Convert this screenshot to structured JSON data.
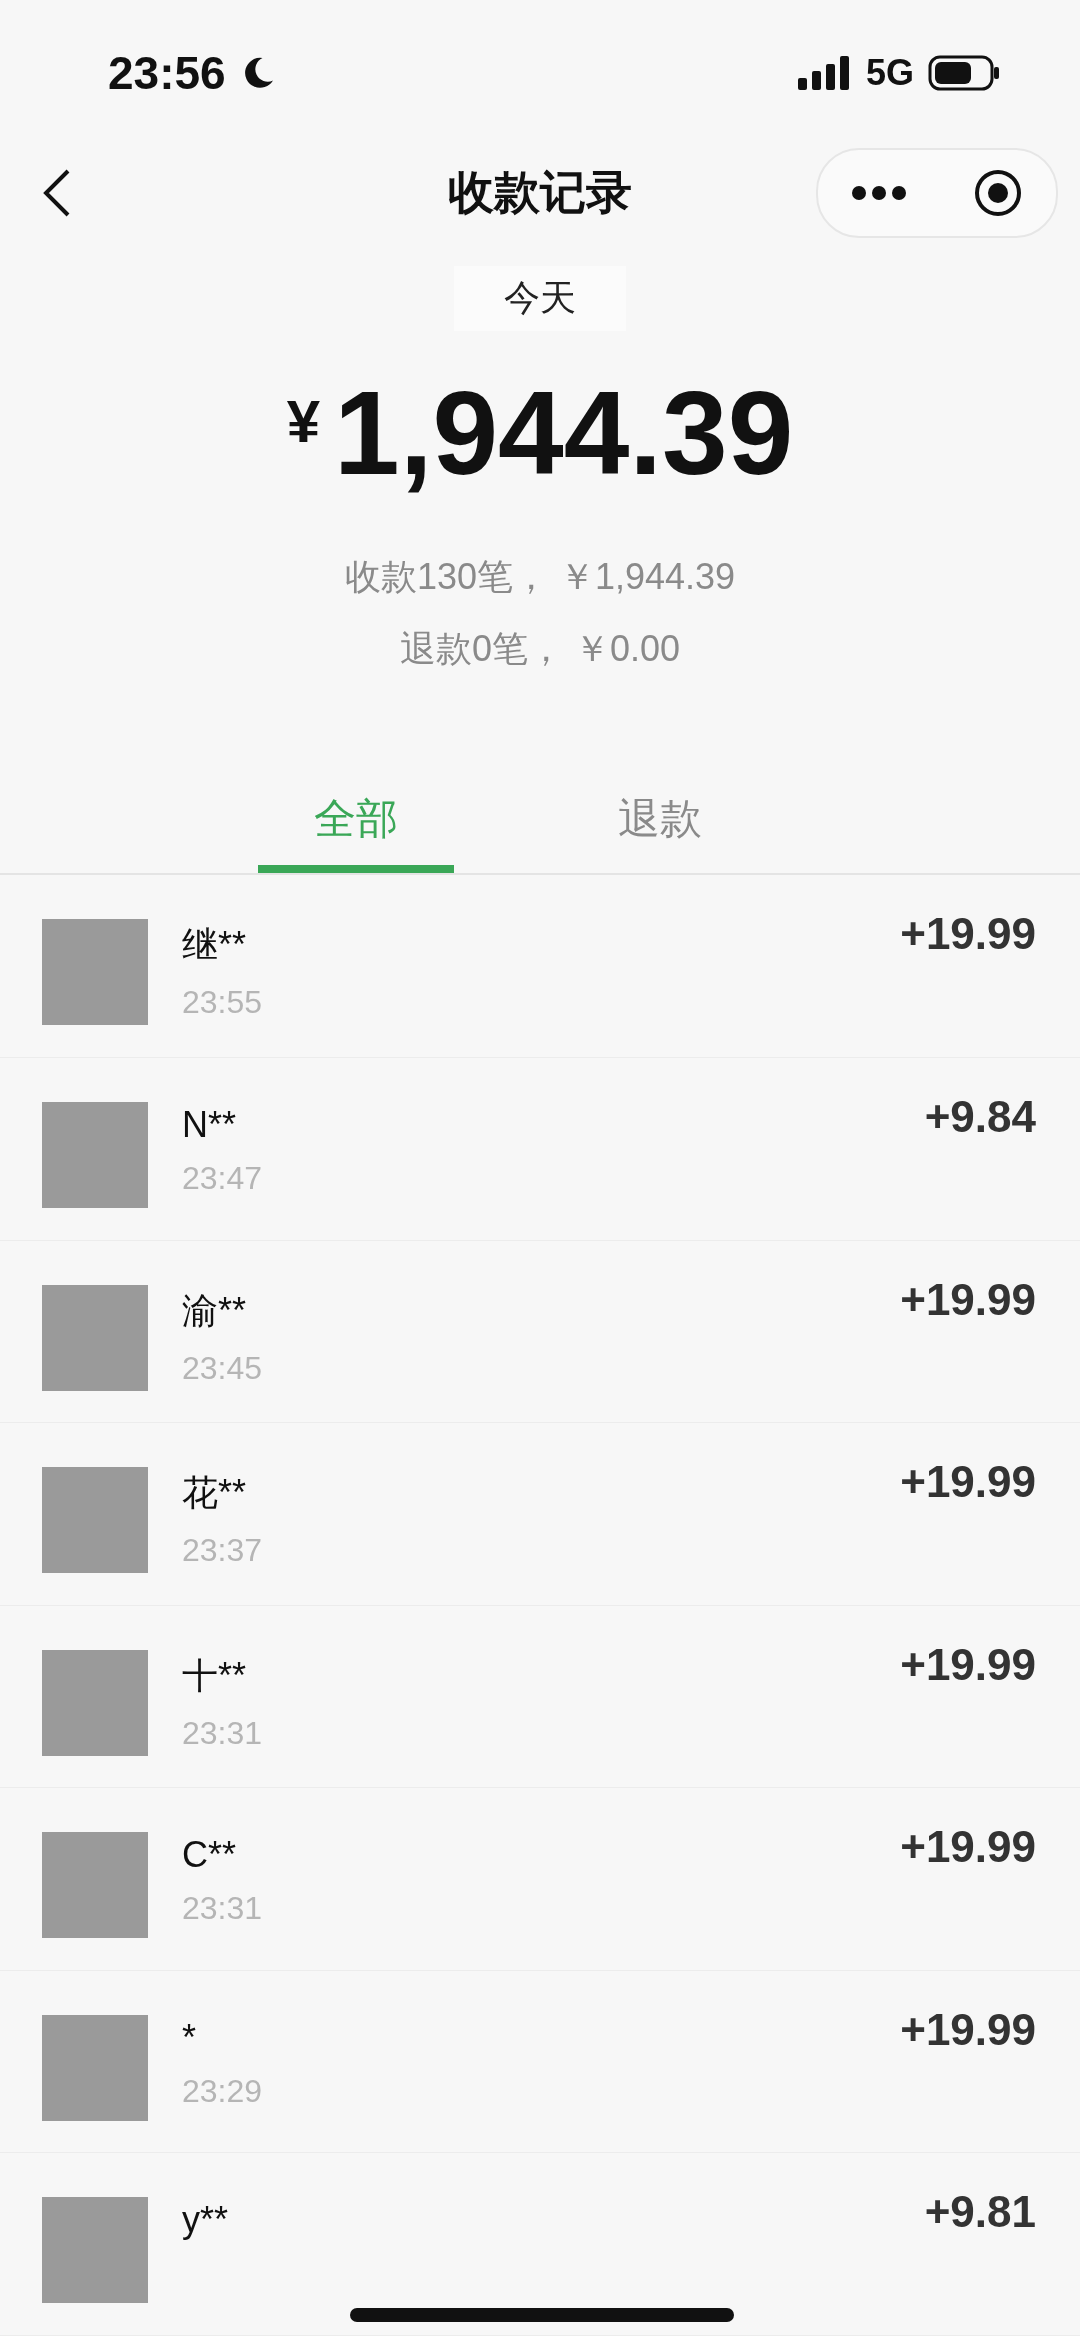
{
  "status_bar": {
    "time": "23:56",
    "network": "5G"
  },
  "nav": {
    "title": "收款记录"
  },
  "summary": {
    "period": "今天",
    "currency": "¥",
    "total": "1,944.39",
    "received": "收款130笔， ￥1,944.39",
    "refunded": "退款0笔， ￥0.00"
  },
  "tabs": [
    {
      "label": "全部",
      "selected": true
    },
    {
      "label": "退款",
      "selected": false
    }
  ],
  "records": [
    {
      "name": "继**",
      "time": "23:55",
      "amount": "+19.99"
    },
    {
      "name": "N**",
      "time": "23:47",
      "amount": "+9.84"
    },
    {
      "name": "渝**",
      "time": "23:45",
      "amount": "+19.99"
    },
    {
      "name": "花**",
      "time": "23:37",
      "amount": "+19.99"
    },
    {
      "name": "十**",
      "time": "23:31",
      "amount": "+19.99"
    },
    {
      "name": "C**",
      "time": "23:31",
      "amount": "+19.99"
    },
    {
      "name": "*",
      "time": "23:29",
      "amount": "+19.99"
    },
    {
      "name": "y**",
      "amount": "+9.81"
    }
  ]
}
